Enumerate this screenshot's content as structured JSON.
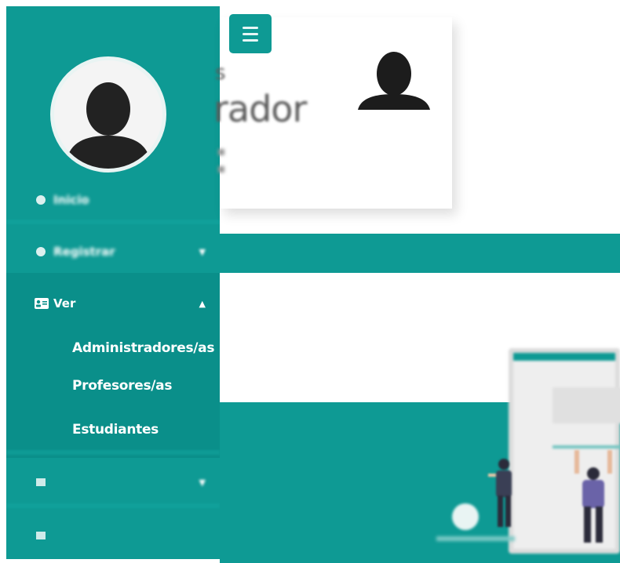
{
  "sidebar": {
    "brand": "",
    "items": [
      {
        "label": "Inicio"
      },
      {
        "label": "Registrar",
        "expanded": false
      },
      {
        "label": "Ver",
        "expanded": true,
        "children": [
          {
            "label": "Administradores/as"
          },
          {
            "label": "Profesores/as"
          },
          {
            "label": "Estudiantes"
          }
        ]
      },
      {
        "label": "",
        "expanded": false
      },
      {
        "label": ""
      }
    ]
  },
  "main": {
    "card": {
      "role_text": "rador"
    },
    "navbar_items": [
      {
        "label": ""
      },
      {
        "label": ""
      },
      {
        "label": ""
      }
    ]
  },
  "colors": {
    "primary": "#0e9a94",
    "sidebar_active_bg": "#0a8f8a",
    "text_light": "#ffffff"
  },
  "icons": {
    "menu": "hamburger-icon",
    "inicio": "home-icon",
    "registrar": "plus-circle-icon",
    "ver": "id-card-icon",
    "cambiar": "edit-icon",
    "salir": "logout-icon",
    "chevron_up": "chevron-up-icon",
    "chevron_down": "chevron-down-icon"
  }
}
